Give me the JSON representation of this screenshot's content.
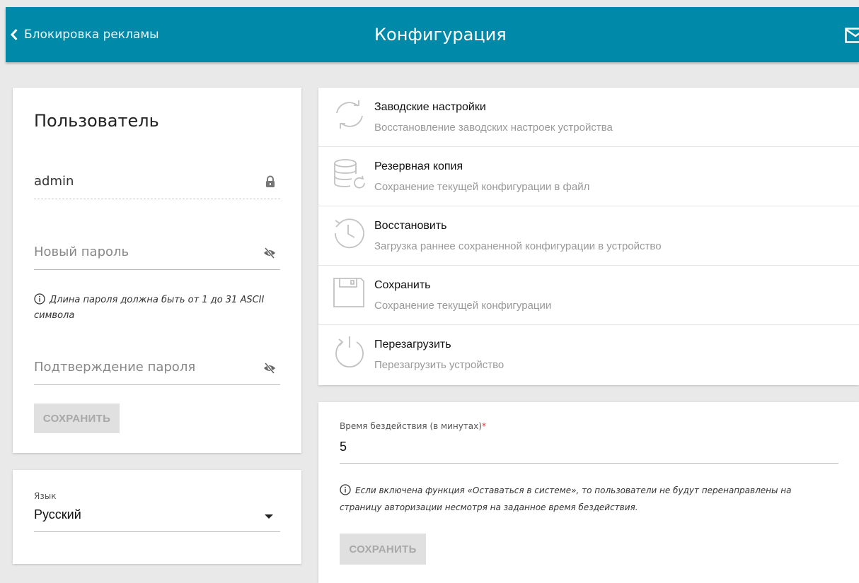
{
  "header": {
    "back_label": "Блокировка рекламы",
    "title": "Конфигурация"
  },
  "user": {
    "title": "Пользователь",
    "username_value": "admin",
    "new_password_placeholder": "Новый пароль",
    "password_hint": "Длина пароля должна быть от 1 до 31 ASCII символа",
    "confirm_password_placeholder": "Подтверждение пароля",
    "save_label": "СОХРАНИТЬ"
  },
  "language": {
    "label": "Язык",
    "selected": "Русский"
  },
  "actions": [
    {
      "title": "Заводские настройки",
      "description": "Восстановление заводских настроек устройства",
      "icon": "factory-reset-icon"
    },
    {
      "title": "Резервная копия",
      "description": "Сохранение текущей конфигурации в файл",
      "icon": "backup-database-icon"
    },
    {
      "title": "Восстановить",
      "description": "Загрузка раннее сохраненной конфигурации в устройство",
      "icon": "restore-history-icon"
    },
    {
      "title": "Сохранить",
      "description": "Сохранение текущей конфигурации",
      "icon": "save-floppy-icon"
    },
    {
      "title": "Перезагрузить",
      "description": "Перезагрузить устройство",
      "icon": "reboot-power-icon"
    }
  ],
  "idle": {
    "label": "Время бездействия (в минутах)",
    "required_mark": "*",
    "value": "5",
    "hint": "Если включена функция «Оставаться в системе», то пользователи не будут перенаправлены на страницу авторизации несмотря на заданное время бездействия.",
    "save_label": "СОХРАНИТЬ"
  },
  "colors": {
    "header_bg": "#0089a8",
    "required": "#e03030",
    "disabled_button_bg": "#e0e0e0"
  }
}
